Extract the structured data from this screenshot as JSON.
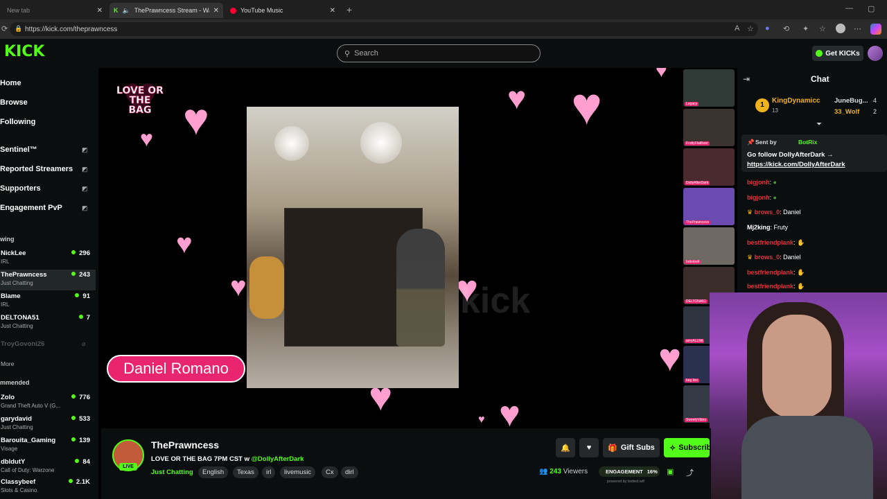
{
  "browser": {
    "tabs": [
      {
        "label": "New tab"
      },
      {
        "label": "ThePrawncess Stream - Watch"
      },
      {
        "label": "YouTube Music"
      }
    ],
    "url": "https://kick.com/theprawncess"
  },
  "header": {
    "logo": "KICK",
    "search_placeholder": "Search",
    "get_kicks": "Get KICKs"
  },
  "sidebar": {
    "nav": [
      "Home",
      "Browse",
      "Following"
    ],
    "tools": [
      "Sentinel™",
      "Reported Streamers",
      "Supporters",
      "Engagement PvP"
    ],
    "following_header": "wing",
    "following": [
      {
        "name": "NickLee",
        "game": "IRL",
        "viewers": "296"
      },
      {
        "name": "ThePrawncess",
        "game": "Just Chatting",
        "viewers": "243"
      },
      {
        "name": "Blame",
        "game": "IRL",
        "viewers": "91"
      },
      {
        "name": "DELTONA51",
        "game": "Just Chatting",
        "viewers": "7"
      }
    ],
    "offline": "TroyGovoni26",
    "more": "More",
    "recommended_header": "mmended",
    "recommended": [
      {
        "name": "Zolo",
        "game": "Grand Theft Auto V (G...",
        "viewers": "776"
      },
      {
        "name": "garydavid",
        "game": "Just Chatting",
        "viewers": "533"
      },
      {
        "name": "Barouita_Gaming",
        "game": "Visage",
        "viewers": "139"
      },
      {
        "name": "dbldutY",
        "game": "Call of Duty: Warzone",
        "viewers": "84"
      },
      {
        "name": "Classybeef",
        "game": "Slots & Casino",
        "viewers": "2.1K"
      }
    ]
  },
  "overlay": {
    "logo_text": "LOVE OR THE BAG",
    "name_plate": "Daniel Romano",
    "watermark": "kick"
  },
  "thumbs": [
    "Legacy",
    "FruttyFlatBeer",
    "DollyAfterDark",
    "ThePrawncess",
    "bobobolt",
    "DELTONA51",
    "amyALLNit",
    "beg bro",
    "SweetyVibes"
  ],
  "chat": {
    "title": "Chat",
    "leaders": [
      {
        "name": "KingDynamicc",
        "count": "13"
      },
      {
        "name": "JuneBug...",
        "count": "4"
      },
      {
        "name": "33_Wolf",
        "count": "2"
      }
    ],
    "pinned": {
      "sender_prefix": "Sent by",
      "sender": "BotRix",
      "text": "Go follow DollyAfterDark →",
      "link": "https://kick.com/DollyAfterDark"
    },
    "messages": [
      {
        "user": "bigjonh",
        "text": ""
      },
      {
        "user": "bigjonh",
        "text": ""
      },
      {
        "user": "brows_0",
        "text": "Daniel"
      },
      {
        "user": "Mj2king",
        "text": "Fruty"
      },
      {
        "user": "bestfriendplank",
        "text": ""
      },
      {
        "user": "brows_0",
        "text": "Daniel"
      },
      {
        "user": "bestfriendplank",
        "text": ""
      },
      {
        "user": "bestfriendplank",
        "text": ""
      }
    ]
  },
  "stream": {
    "streamer": "ThePrawncess",
    "live_label": "LIVE",
    "title_prefix": "LOVE OR THE BAG 7PM CST w",
    "title_mention": "@DollyAfterDark",
    "category": "Just Chatting",
    "tags": [
      "English",
      "Texas",
      "irl",
      "livemusic",
      "Cx",
      "dirl"
    ],
    "viewers": "243",
    "viewers_label": "Viewers",
    "gift_subs": "Gift Subs",
    "subscribe": "Subscribe",
    "engagement_label": "ENGAGEMENT",
    "engagement_value": "16%",
    "powered_by": "powered by botted.wtf"
  },
  "colors": {
    "accent": "#53fc18",
    "pink": "#e8256e"
  }
}
